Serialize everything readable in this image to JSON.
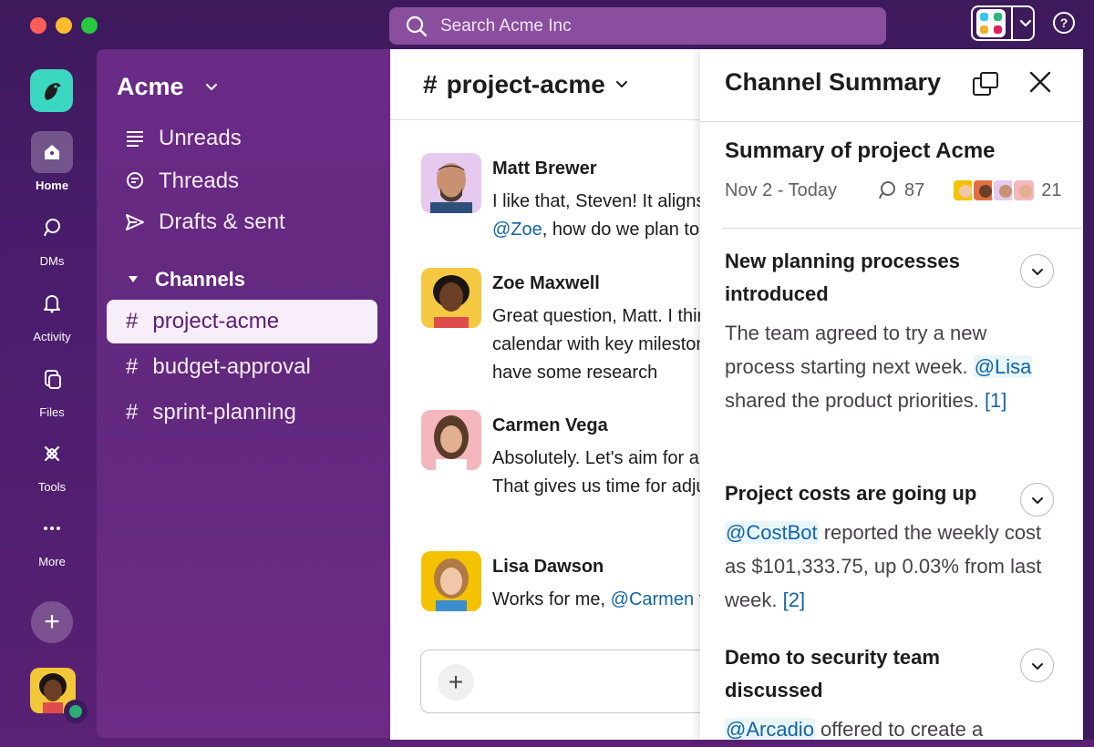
{
  "titlebar": {
    "search_placeholder": "Search Acme Inc",
    "help_label": "?"
  },
  "rail": {
    "items": [
      {
        "label": "Home",
        "icon": "home-icon",
        "active": true
      },
      {
        "label": "DMs",
        "icon": "dm-icon"
      },
      {
        "label": "Activity",
        "icon": "bell-icon"
      },
      {
        "label": "Files",
        "icon": "files-icon"
      },
      {
        "label": "Tools",
        "icon": "tools-icon"
      },
      {
        "label": "More",
        "icon": "more-icon"
      }
    ],
    "add_label": "+"
  },
  "sidebar": {
    "workspace": "Acme",
    "nav": [
      {
        "label": "Unreads",
        "icon": "unreads-icon"
      },
      {
        "label": "Threads",
        "icon": "threads-icon"
      },
      {
        "label": "Drafts & sent",
        "icon": "send-icon"
      }
    ],
    "channels_header": "Channels",
    "channels": [
      {
        "name": "project-acme",
        "active": true
      },
      {
        "name": "budget-approval"
      },
      {
        "name": "sprint-planning"
      }
    ]
  },
  "main": {
    "channel_title": "project-acme",
    "messages": [
      {
        "author": "Matt Brewer",
        "line1": "I like that, Steven! It aligns",
        "mention": "@Zoe",
        "rest": ", how do we plan to"
      },
      {
        "author": "Zoe Maxwell",
        "body": "Great question, Matt. I think we should create a calendar with key milestones and share it once you have some research"
      },
      {
        "author": "Carmen Vega",
        "body": "Absolutely. Let's aim for a full-blown launch in eight. That gives us time for adjustments. Does that timeline"
      },
      {
        "author": "Lisa Dawson",
        "pre": "Works for me, ",
        "mention": "@Carmen",
        "rest": " taglines and messaging ideas"
      }
    ],
    "composer_plus": "+"
  },
  "summary": {
    "title": "Channel Summary",
    "subtitle": "Summary of project Acme",
    "date_range": "Nov 2 - Today",
    "reply_count": "87",
    "member_count": "21",
    "sections": [
      {
        "heading": "New planning processes introduced",
        "text1": "The team agreed to try a new process starting next week. ",
        "mention": "@Lisa",
        "text2": " shared the product priorities. ",
        "ref": "[1]"
      },
      {
        "heading": "Project costs are going up",
        "mention": "@CostBot",
        "text2": " reported the weekly cost as $101,333.75, up 0.03% from last week. ",
        "ref": "[2]"
      },
      {
        "heading": "Demo to security team discussed",
        "mention": "@Arcadio",
        "text2": " offered to create a"
      }
    ]
  },
  "colors": {
    "accent_purple": "#3d1a5c",
    "sidebar_purple": "#6a2b86",
    "link_blue": "#1264a3",
    "brand_teal": "#3bd7c1",
    "presence_green": "#2bac76"
  }
}
